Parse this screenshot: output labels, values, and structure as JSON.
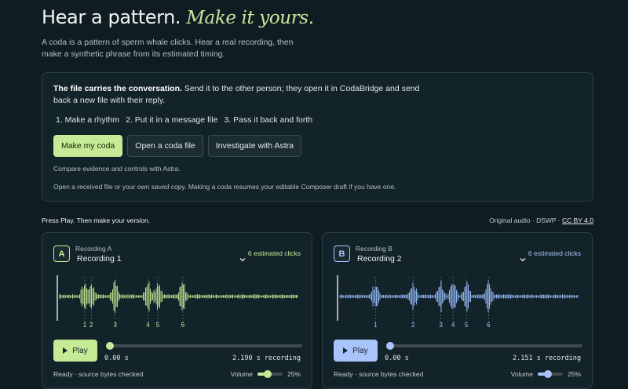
{
  "hero": {
    "title_plain": "Hear a pattern.",
    "title_em": "Make it yours.",
    "intro": "A coda is a pattern of sperm whale clicks. Hear a real recording, then make a synthetic phrase from its estimated timing."
  },
  "panel": {
    "lead_bold": "The file carries the conversation.",
    "lead_rest": " Send it to the other person; they open it in CodaBridge and send back a new file with their reply.",
    "steps": [
      "1. Make a rhythm",
      "2. Put it in a message file",
      "3. Pass it back and forth"
    ],
    "buttons": {
      "make": "Make my coda",
      "open": "Open a coda file",
      "investigate": "Investigate with Astra"
    },
    "note1": "Compare evidence and controls with Astra.",
    "note2": "Open a received file or your own saved copy. Making a coda resumes your editable Composer draft if you have one."
  },
  "bar": {
    "prompt": "Press Play. Then make your version.",
    "source": "Original audio · DSWP · ",
    "license": "CC BY 4.0"
  },
  "recordings": [
    {
      "badge": "A",
      "sub": "Recording A",
      "name": "Recording 1",
      "clicks_label": "6 estimated clicks",
      "click_times": [
        0.23,
        0.29,
        0.51,
        0.81,
        0.9,
        1.13
      ],
      "tick_labels": [
        "1",
        "2",
        "3",
        "4",
        "5",
        "6"
      ],
      "duration_s": 2.19,
      "play": "Play",
      "time_current": "0.00 s",
      "time_total": "2.190 s recording",
      "progress": 0.0,
      "status": "Ready · source bytes checked",
      "volume_label": "Volume",
      "volume_pct": 25,
      "volume_text": "25%",
      "accent": "#c6eb96",
      "wave_color": "#b8d98a"
    },
    {
      "badge": "B",
      "sub": "Recording B",
      "name": "Recording 2",
      "clicks_label": "6 estimated clicks",
      "click_times": [
        0.32,
        0.66,
        0.91,
        1.02,
        1.14,
        1.34
      ],
      "tick_labels": [
        "1",
        "2",
        "3",
        "4",
        "5",
        "6"
      ],
      "duration_s": 2.151,
      "play": "Play",
      "time_current": "0.00 s",
      "time_total": "2.151 s recording",
      "progress": 0.0,
      "status": "Ready · source bytes checked",
      "volume_label": "Volume",
      "volume_pct": 25,
      "volume_text": "25%",
      "accent": "#a9c4fb",
      "wave_color": "#8fb1ee"
    }
  ]
}
